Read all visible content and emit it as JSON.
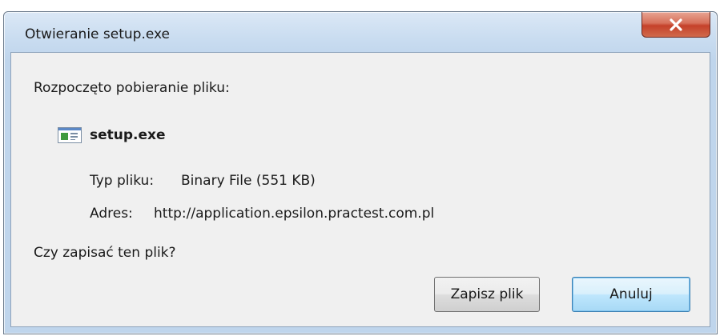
{
  "window": {
    "title": "Otwieranie setup.exe",
    "close_icon": "close-x-icon"
  },
  "content": {
    "intro": "Rozpoczęto pobieranie pliku:",
    "file_icon": "application-window-icon",
    "filename": "setup.exe",
    "type_label": "Typ pliku:",
    "type_value": "Binary File (551 KB)",
    "address_label": "Adres:",
    "address_value": "http://application.epsilon.practest.com.pl",
    "question": "Czy zapisać ten plik?"
  },
  "buttons": {
    "save_label": "Zapisz plik",
    "cancel_label": "Anuluj"
  },
  "colors": {
    "close_button": "#c5412a",
    "frame": "#c9dcf0",
    "client_background": "#f0f0f0",
    "default_button_border": "#3c7fb1"
  }
}
